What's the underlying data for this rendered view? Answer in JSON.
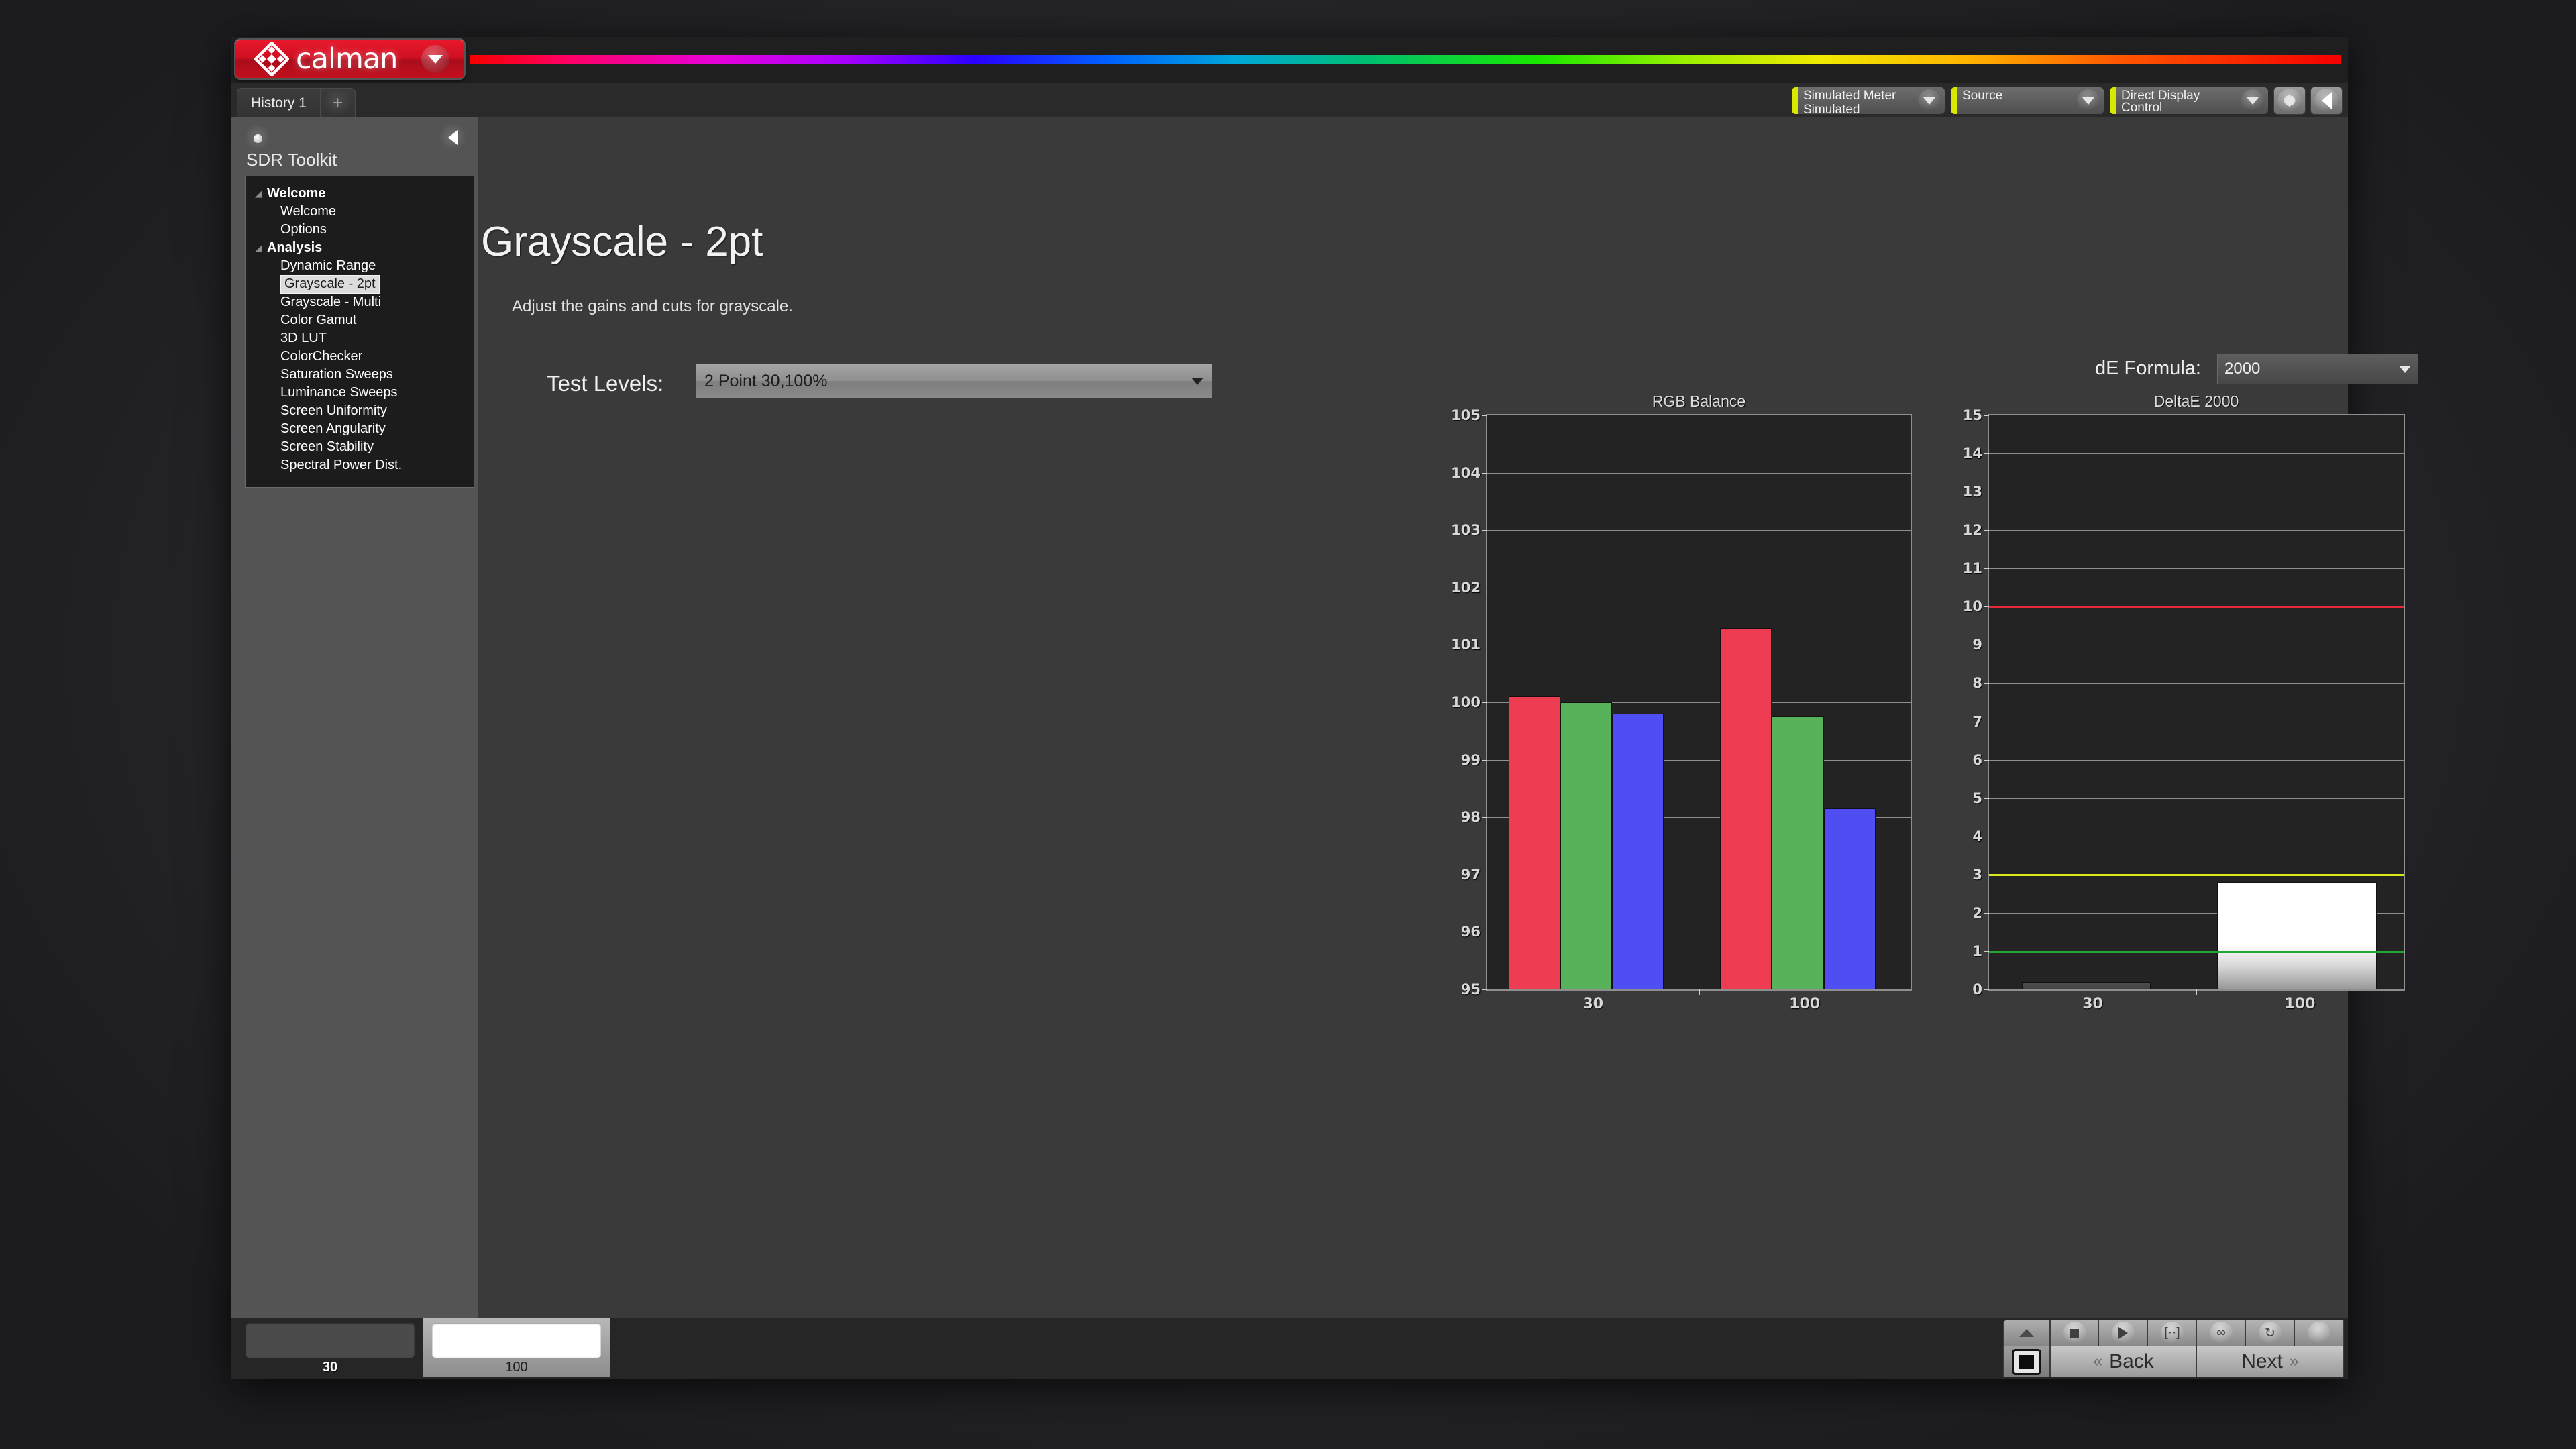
{
  "app": {
    "brand": "calman",
    "brand_color": "#cf0f22",
    "logo_icon": "diamond-logo-icon",
    "brand_caret_icon": "chevron-down-icon"
  },
  "tabs": {
    "items": [
      {
        "label": "History 1"
      }
    ],
    "add_label": "+"
  },
  "toolbar": {
    "meter": {
      "title": "Simulated Meter",
      "value": "Simulated",
      "accent": "#d8e800"
    },
    "source": {
      "title": "Source",
      "value": "",
      "accent": "#d8e800"
    },
    "display": {
      "title": "Direct Display Control",
      "value": "",
      "accent": "#d8e800"
    },
    "settings_icon": "gear-icon",
    "collapse_icon": "chevron-left-icon"
  },
  "sidebar": {
    "title": "SDR Toolkit",
    "dot_icon": "record-dot-icon",
    "collapse_icon": "chevron-left-icon",
    "tree": [
      {
        "label": "Welcome",
        "type": "group"
      },
      {
        "label": "Welcome",
        "type": "child"
      },
      {
        "label": "Options",
        "type": "child"
      },
      {
        "label": "Analysis",
        "type": "group"
      },
      {
        "label": "Dynamic Range",
        "type": "child"
      },
      {
        "label": "Grayscale - 2pt",
        "type": "child",
        "selected": true
      },
      {
        "label": "Grayscale - Multi",
        "type": "child"
      },
      {
        "label": "Color Gamut",
        "type": "child"
      },
      {
        "label": "3D LUT",
        "type": "child"
      },
      {
        "label": "ColorChecker",
        "type": "child"
      },
      {
        "label": "Saturation Sweeps",
        "type": "child"
      },
      {
        "label": "Luminance Sweeps",
        "type": "child"
      },
      {
        "label": "Screen Uniformity",
        "type": "child"
      },
      {
        "label": "Screen Angularity",
        "type": "child"
      },
      {
        "label": "Screen Stability",
        "type": "child"
      },
      {
        "label": "Spectral Power Dist.",
        "type": "child"
      }
    ]
  },
  "page": {
    "title": "Grayscale - 2pt",
    "subtitle": "Adjust the gains and cuts for grayscale.",
    "test_levels_label": "Test Levels:",
    "test_levels_value": "2 Point 30,100%",
    "de_formula_label": "dE Formula:",
    "de_formula_value": "2000",
    "dropdown_icon": "chevron-down-icon"
  },
  "chart_data": [
    {
      "type": "bar",
      "title": "RGB Balance",
      "categories": [
        "30",
        "100"
      ],
      "series": [
        {
          "name": "Red",
          "color": "#ee3c52",
          "values": [
            100.1,
            101.3
          ]
        },
        {
          "name": "Green",
          "color": "#58b25a",
          "values": [
            100.0,
            99.75
          ]
        },
        {
          "name": "Blue",
          "color": "#4f4ef2",
          "values": [
            99.8,
            98.15
          ]
        }
      ],
      "xlabel": "",
      "ylabel": "",
      "ylim": [
        95,
        105
      ],
      "yticks": [
        95,
        96,
        97,
        98,
        99,
        100,
        101,
        102,
        103,
        104,
        105
      ],
      "grid": true,
      "legend": "none"
    },
    {
      "type": "bar",
      "title": "DeltaE 2000",
      "categories": [
        "30",
        "100"
      ],
      "series": [
        {
          "name": "dE",
          "values": [
            0.2,
            2.8
          ]
        }
      ],
      "xlabel": "",
      "ylabel": "",
      "ylim": [
        0,
        15
      ],
      "yticks": [
        0,
        1,
        2,
        3,
        4,
        5,
        6,
        7,
        8,
        9,
        10,
        11,
        12,
        13,
        14,
        15
      ],
      "reference_lines": [
        {
          "value": 10,
          "color": "#e8263c"
        },
        {
          "value": 3,
          "color": "#d8e818"
        },
        {
          "value": 1,
          "color": "#1fa82f"
        }
      ],
      "grid": true,
      "legend": "none"
    }
  ],
  "patches": {
    "items": [
      {
        "label": "30",
        "color": "#4b4b4b",
        "selected": false
      },
      {
        "label": "100",
        "color": "#ffffff",
        "selected": true
      }
    ]
  },
  "nav": {
    "up_icon": "chevron-up-icon",
    "preview_icon": "pattern-preview-icon",
    "icons": [
      {
        "name": "stop-icon",
        "glyph": ""
      },
      {
        "name": "play-icon",
        "glyph": ""
      },
      {
        "name": "brackets-icon",
        "glyph": "[··]"
      },
      {
        "name": "infinity-icon",
        "glyph": "∞"
      },
      {
        "name": "refresh-icon",
        "glyph": "↻"
      },
      {
        "name": "blank-icon",
        "glyph": ""
      }
    ],
    "back_label": "Back",
    "next_label": "Next",
    "back_icon": "chevron-double-left-icon",
    "next_icon": "chevron-double-right-icon"
  }
}
